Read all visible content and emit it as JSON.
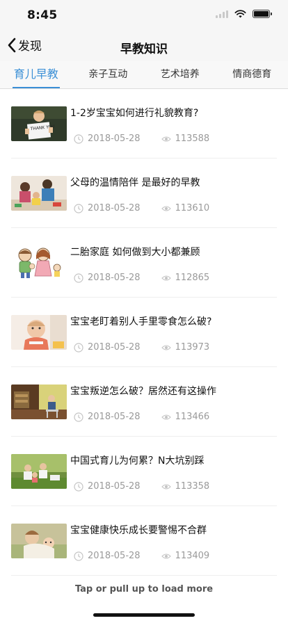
{
  "status": {
    "time": "8:45"
  },
  "nav": {
    "back_label": "发现",
    "title": "早教知识"
  },
  "tabs": [
    {
      "label": "育儿早教",
      "active": true
    },
    {
      "label": "亲子互动",
      "active": false
    },
    {
      "label": "艺术培养",
      "active": false
    },
    {
      "label": "情商德育",
      "active": false
    }
  ],
  "articles": [
    {
      "title": "1-2岁宝宝如何进行礼貌教育?",
      "date": "2018-05-28",
      "views": "113588",
      "thumb": "boy-thank-you-sign",
      "thumb_text": "THANK YOU"
    },
    {
      "title": "父母的温情陪伴 是最好的早教",
      "date": "2018-05-28",
      "views": "113610",
      "thumb": "family-playing"
    },
    {
      "title": "二胎家庭 如何做到大小都兼顾",
      "date": "2018-05-28",
      "views": "112865",
      "thumb": "cartoon-family"
    },
    {
      "title": "宝宝老盯着别人手里零食怎么破?",
      "date": "2018-05-28",
      "views": "113973",
      "thumb": "baby-eating"
    },
    {
      "title": "宝宝叛逆怎么破？居然还有这操作",
      "date": "2018-05-28",
      "views": "113466",
      "thumb": "child-in-room"
    },
    {
      "title": "中国式育儿为何累？N大坑别踩",
      "date": "2018-05-28",
      "views": "113358",
      "thumb": "family-on-grass"
    },
    {
      "title": "宝宝健康快乐成长要警惕不合群",
      "date": "2018-05-28",
      "views": "113409",
      "thumb": "mother-and-baby"
    }
  ],
  "footer": {
    "load_more": "Tap or pull up to load more"
  },
  "colors": {
    "accent": "#3a8fd6",
    "meta": "#9a9a9a",
    "bar": "#f6f6f6"
  }
}
